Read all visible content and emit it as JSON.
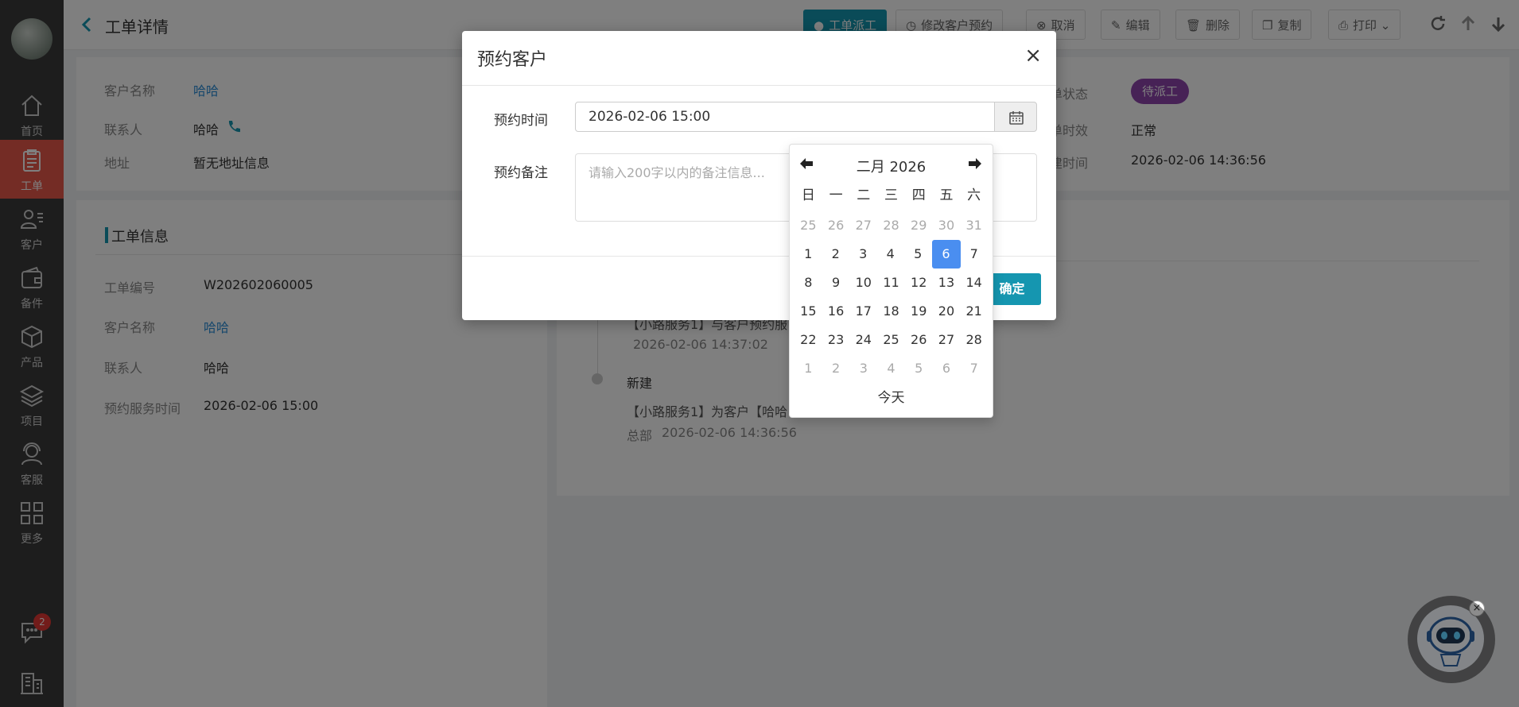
{
  "sidebar": {
    "items": [
      {
        "label": "首页",
        "icon": "home-icon"
      },
      {
        "label": "工单",
        "icon": "clipboard-icon"
      },
      {
        "label": "客户",
        "icon": "user-list-icon"
      },
      {
        "label": "备件",
        "icon": "wallet-icon"
      },
      {
        "label": "产品",
        "icon": "box-icon"
      },
      {
        "label": "项目",
        "icon": "layers-icon"
      },
      {
        "label": "客服",
        "icon": "headset-icon"
      },
      {
        "label": "更多",
        "icon": "grid-icon"
      }
    ],
    "active_index": 1,
    "chat_badge": "2"
  },
  "header": {
    "title": "工单详情",
    "buttons": {
      "dispatch": "工单派工",
      "modify_appointment": "修改客户预约",
      "cancel": "取消",
      "edit": "编辑",
      "delete": "删除",
      "copy": "复制",
      "print": "打印"
    }
  },
  "customer": {
    "name_label": "客户名称",
    "name": "哈哈",
    "contact_label": "联系人",
    "contact": "哈哈",
    "address_label": "地址",
    "address": "暂无地址信息",
    "status_label": "单状态",
    "status": "待派工",
    "timeliness_label": "单时效",
    "timeliness": "正常",
    "created_label": "建时间",
    "created": "2026-02-06 14:36:56"
  },
  "ticket_info": {
    "section_title": "工单信息",
    "number_label": "工单编号",
    "number": "W202602060005",
    "customer_label": "客户名称",
    "customer": "哈哈",
    "contact_label": "联系人",
    "contact": "哈哈",
    "service_time_label": "预约服务时间",
    "service_time": "2026-02-06 15:00"
  },
  "timeline": {
    "item1_text": "【小路服务1】与客户预约服",
    "item1_time": "2026-02-06 14:37:02",
    "item2_title": "新建",
    "item2_text": "【小路服务1】为客户【哈哈",
    "item2_org": "总部",
    "item2_time": "2026-02-06 14:36:56"
  },
  "modal": {
    "title": "预约客户",
    "close": "×",
    "time_label": "预约时间",
    "time_value": "2026-02-06 15:00",
    "remark_label": "预约备注",
    "remark_placeholder": "请输入200字以内的备注信息...",
    "confirm": "确定"
  },
  "datepicker": {
    "title": "二月 2026",
    "weekdays": [
      "日",
      "一",
      "二",
      "三",
      "四",
      "五",
      "六"
    ],
    "weeks": [
      [
        {
          "d": "25",
          "m": 1
        },
        {
          "d": "26",
          "m": 1
        },
        {
          "d": "27",
          "m": 1
        },
        {
          "d": "28",
          "m": 1
        },
        {
          "d": "29",
          "m": 1
        },
        {
          "d": "30",
          "m": 1
        },
        {
          "d": "31",
          "m": 1
        }
      ],
      [
        {
          "d": "1"
        },
        {
          "d": "2"
        },
        {
          "d": "3"
        },
        {
          "d": "4"
        },
        {
          "d": "5"
        },
        {
          "d": "6",
          "s": 1
        },
        {
          "d": "7"
        }
      ],
      [
        {
          "d": "8"
        },
        {
          "d": "9"
        },
        {
          "d": "10"
        },
        {
          "d": "11"
        },
        {
          "d": "12"
        },
        {
          "d": "13"
        },
        {
          "d": "14"
        }
      ],
      [
        {
          "d": "15"
        },
        {
          "d": "16"
        },
        {
          "d": "17"
        },
        {
          "d": "18"
        },
        {
          "d": "19"
        },
        {
          "d": "20"
        },
        {
          "d": "21"
        }
      ],
      [
        {
          "d": "22"
        },
        {
          "d": "23"
        },
        {
          "d": "24"
        },
        {
          "d": "25"
        },
        {
          "d": "26"
        },
        {
          "d": "27"
        },
        {
          "d": "28"
        }
      ],
      [
        {
          "d": "1",
          "m": 1
        },
        {
          "d": "2",
          "m": 1
        },
        {
          "d": "3",
          "m": 1
        },
        {
          "d": "4",
          "m": 1
        },
        {
          "d": "5",
          "m": 1
        },
        {
          "d": "6",
          "m": 1
        },
        {
          "d": "7",
          "m": 1
        }
      ]
    ],
    "today": "今天"
  },
  "colors": {
    "accent": "#1596b0",
    "sidebar_active": "#e8584a",
    "selected_day": "#4a8ef0",
    "status_badge": "#8e44ad"
  }
}
